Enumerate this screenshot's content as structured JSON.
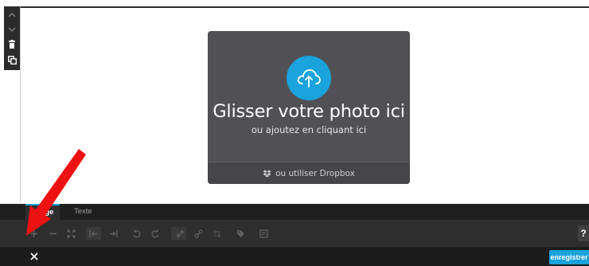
{
  "dropzone": {
    "title": "Glisser votre photo ici",
    "subtitle": "ou ajoutez en cliquant ici",
    "dropbox_label": "ou utiliser Dropbox"
  },
  "tabs": [
    {
      "label": "Image",
      "active": true
    },
    {
      "label": "Texte",
      "active": false
    }
  ],
  "toolbar": {
    "help_label": "?",
    "tools": [
      "zoom-in-icon",
      "zoom-out-icon",
      "fit-icon",
      "align-left-icon",
      "align-right-icon",
      "rotate-left-icon",
      "rotate-right-icon",
      "expand-icon",
      "link-icon",
      "crop-icon",
      "tag-icon",
      "caption-icon"
    ]
  },
  "actions": {
    "close_label": "×",
    "save_label": "enregistrer"
  },
  "colors": {
    "accent": "#1aa3dc",
    "dropzone_bg": "#515155",
    "panel_bg": "#2e2e2e",
    "annotation": "#ee1111"
  }
}
